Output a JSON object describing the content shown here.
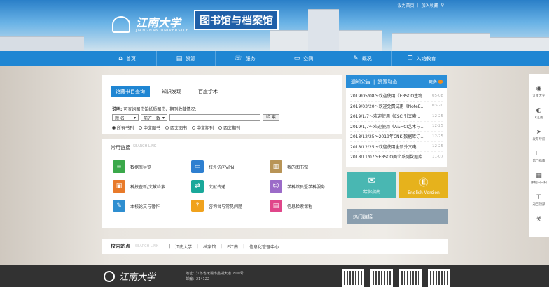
{
  "header": {
    "logo_cn": "江南大学",
    "logo_en": "JIANGNAN UNIVERSITY",
    "site_title": "图书馆与档案馆",
    "top_links": [
      "设为首页",
      "加入收藏"
    ]
  },
  "nav": [
    {
      "label": "首页",
      "icon": "home-icon",
      "glyph": "⌂"
    },
    {
      "label": "资源",
      "icon": "books-icon",
      "glyph": "▤"
    },
    {
      "label": "服务",
      "icon": "service-icon",
      "glyph": "☏"
    },
    {
      "label": "空间",
      "icon": "folder-icon",
      "glyph": "▭"
    },
    {
      "label": "概况",
      "icon": "edit-icon",
      "glyph": "✎"
    },
    {
      "label": "入馆教育",
      "icon": "book-open-icon",
      "glyph": "❒"
    }
  ],
  "search": {
    "tabs": [
      "馆藏书目查询",
      "知识发现",
      "百度学术"
    ],
    "label_bold": "说明:",
    "label_text": "可查询图书馆纸质图书、期刊收藏情况:",
    "select1": "题 名",
    "select2": "前方一致",
    "button": "检 索",
    "radios": [
      "所有书刊",
      "中文图书",
      "西文图书",
      "中文期刊",
      "西文期刊"
    ]
  },
  "quick_links": {
    "title": "常用链接",
    "subtitle": "SEARCH LINK",
    "items": [
      {
        "label": "数据库导览",
        "color": "#3aa84a",
        "glyph": "≡"
      },
      {
        "label": "校外访问VPN",
        "color": "#2e7fd0",
        "glyph": "▭"
      },
      {
        "label": "我的图书馆",
        "color": "#b89456",
        "glyph": "▥"
      },
      {
        "label": "科技查新/文献检索",
        "color": "#e87a2a",
        "glyph": "▣"
      },
      {
        "label": "文献传递",
        "color": "#19a89a",
        "glyph": "⇄"
      },
      {
        "label": "学科馆员暨学科服务",
        "color": "#9b6bc8",
        "glyph": "☺"
      },
      {
        "label": "本校论文与著作",
        "color": "#2e8ed0",
        "glyph": "✎"
      },
      {
        "label": "咨询台与常见问题",
        "color": "#f0a21d",
        "glyph": "?"
      },
      {
        "label": "信息检索课程",
        "color": "#e0468a",
        "glyph": "▤"
      }
    ]
  },
  "notice": {
    "tab1": "通知公告",
    "tab2": "资源动态",
    "more": "更多",
    "items": [
      {
        "text": "2019/05/08～欢迎使用《EBSCO生物…",
        "date": "05-08"
      },
      {
        "text": "2019/03/20～欢迎免费试用《NoteE…",
        "date": "03-20"
      },
      {
        "text": "2019/1/7～欢迎使用《ESCI引文索…",
        "date": "12-25"
      },
      {
        "text": "2019/1/7～欢迎使用《A&HCI艺术与…",
        "date": "12-25"
      },
      {
        "text": "2018/12/25～2019年CNKI数据库订…",
        "date": "12-25"
      },
      {
        "text": "2018/12/25～欢迎使用全新外文电…",
        "date": "12-25"
      },
      {
        "text": "2018/11/07～EBSCO两个系列数据库…",
        "date": "11-07"
      }
    ]
  },
  "buttons": {
    "guide": "给你指南",
    "english": "English Version"
  },
  "hot_links": "热门链接",
  "campus": {
    "title": "校内站点",
    "subtitle": "SEARCH LINK",
    "links": [
      "江南大学",
      "档案馆",
      "E江南",
      "信息化管理中心"
    ]
  },
  "footer": {
    "logo_cn": "江南大学",
    "address_line1": "地址：江苏省无锡市蠡湖大道1800号",
    "address_line2": "邮编：214122"
  },
  "sidebar": [
    {
      "label": "江南大学",
      "glyph": "◉"
    },
    {
      "label": "E江南",
      "glyph": "◐"
    },
    {
      "label": "发布导航",
      "glyph": "➤"
    },
    {
      "label": "馆门指南",
      "glyph": "❐"
    },
    {
      "label": "手机扫一扫",
      "glyph": "▦"
    },
    {
      "label": "返回顶部",
      "glyph": "⊤"
    },
    {
      "label": "关",
      "glyph": ""
    }
  ]
}
